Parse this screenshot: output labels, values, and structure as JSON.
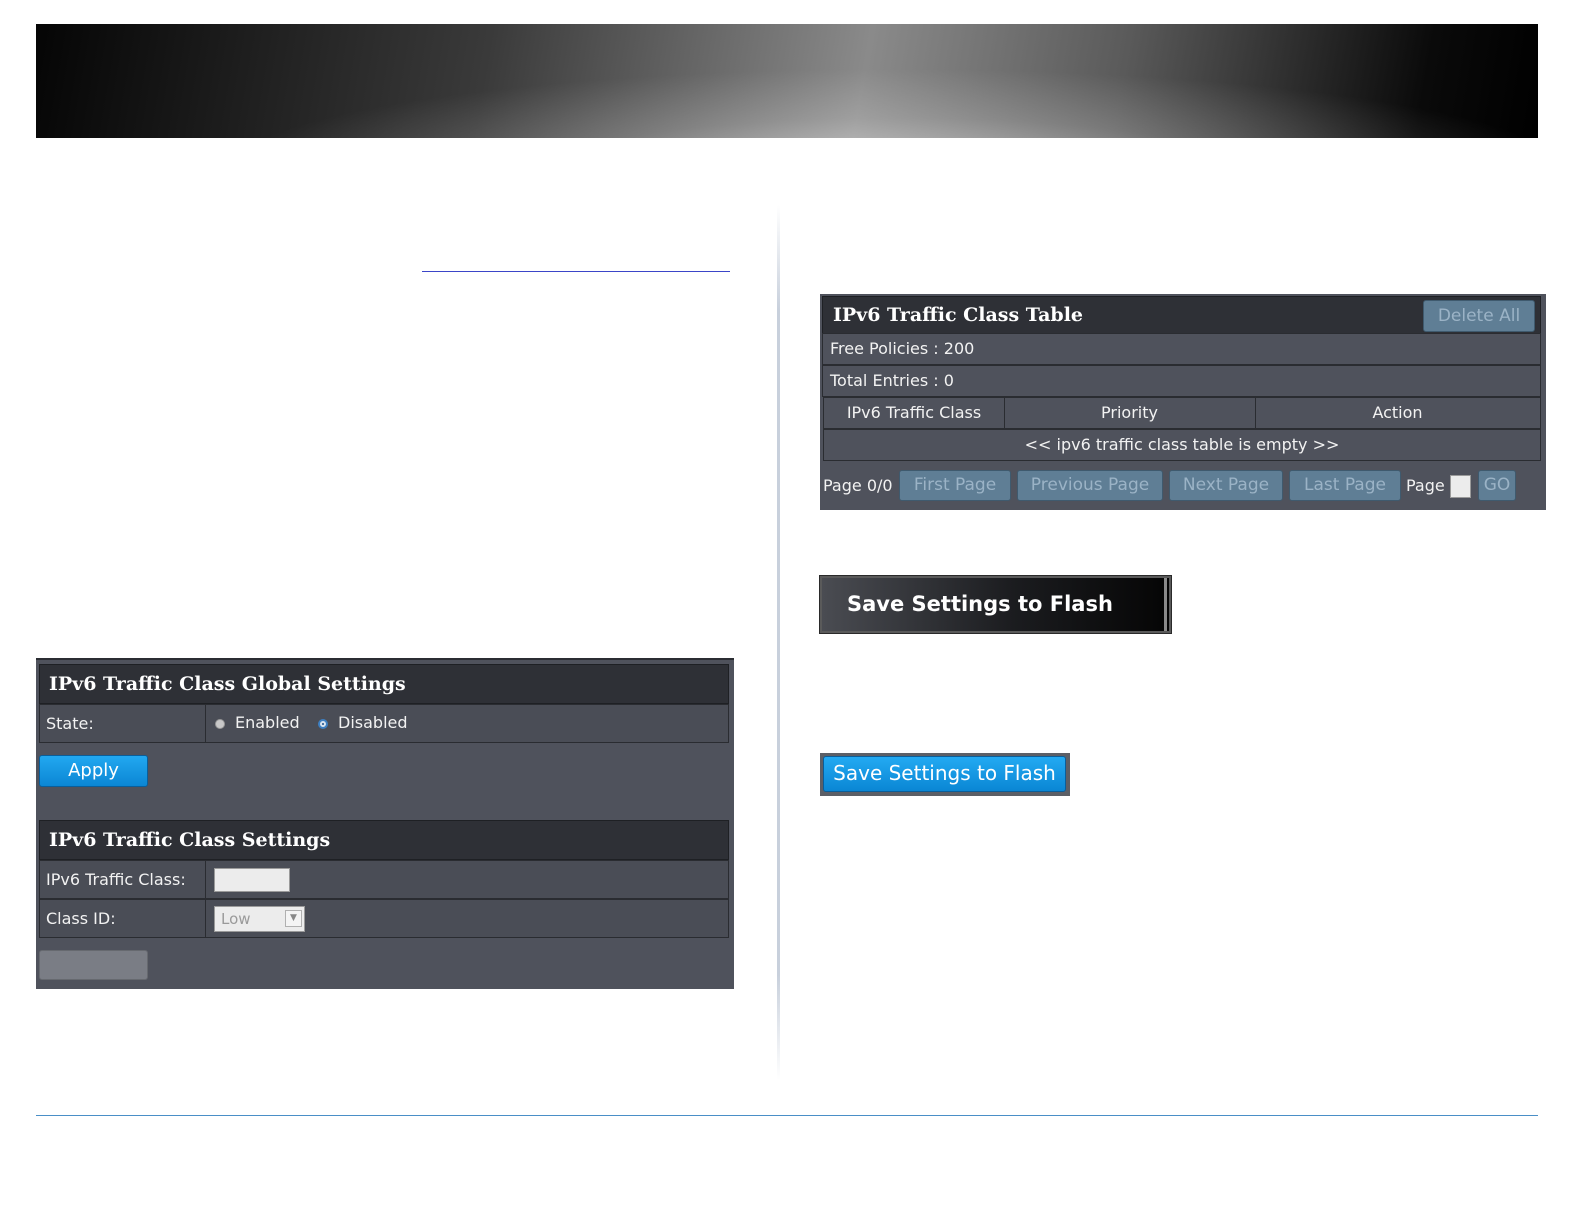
{
  "global_settings": {
    "title": "IPv6 Traffic Class Global Settings",
    "state_label": "State:",
    "state_options": [
      "Enabled",
      "Disabled"
    ],
    "state_selected": "Disabled",
    "apply_label": "Apply"
  },
  "class_settings": {
    "title": "IPv6 Traffic Class Settings",
    "traffic_class_label": "IPv6 Traffic Class:",
    "traffic_class_value": "",
    "class_id_label": "Class ID:",
    "class_id_selected": "Low"
  },
  "table": {
    "title": "IPv6 Traffic Class Table",
    "delete_all_label": "Delete All",
    "free_policies": "Free Policies : 200",
    "total_entries": "Total Entries : 0",
    "columns": [
      "IPv6 Traffic Class",
      "Priority",
      "Action"
    ],
    "empty_message": "<< ipv6 traffic class table is empty >>",
    "pager": {
      "page_status": "Page 0/0",
      "first": "First Page",
      "previous": "Previous Page",
      "next": "Next Page",
      "last": "Last Page",
      "page_label": "Page",
      "go": "GO"
    }
  },
  "save_dark_label": "Save Settings to Flash",
  "save_blue_label": "Save Settings to Flash"
}
